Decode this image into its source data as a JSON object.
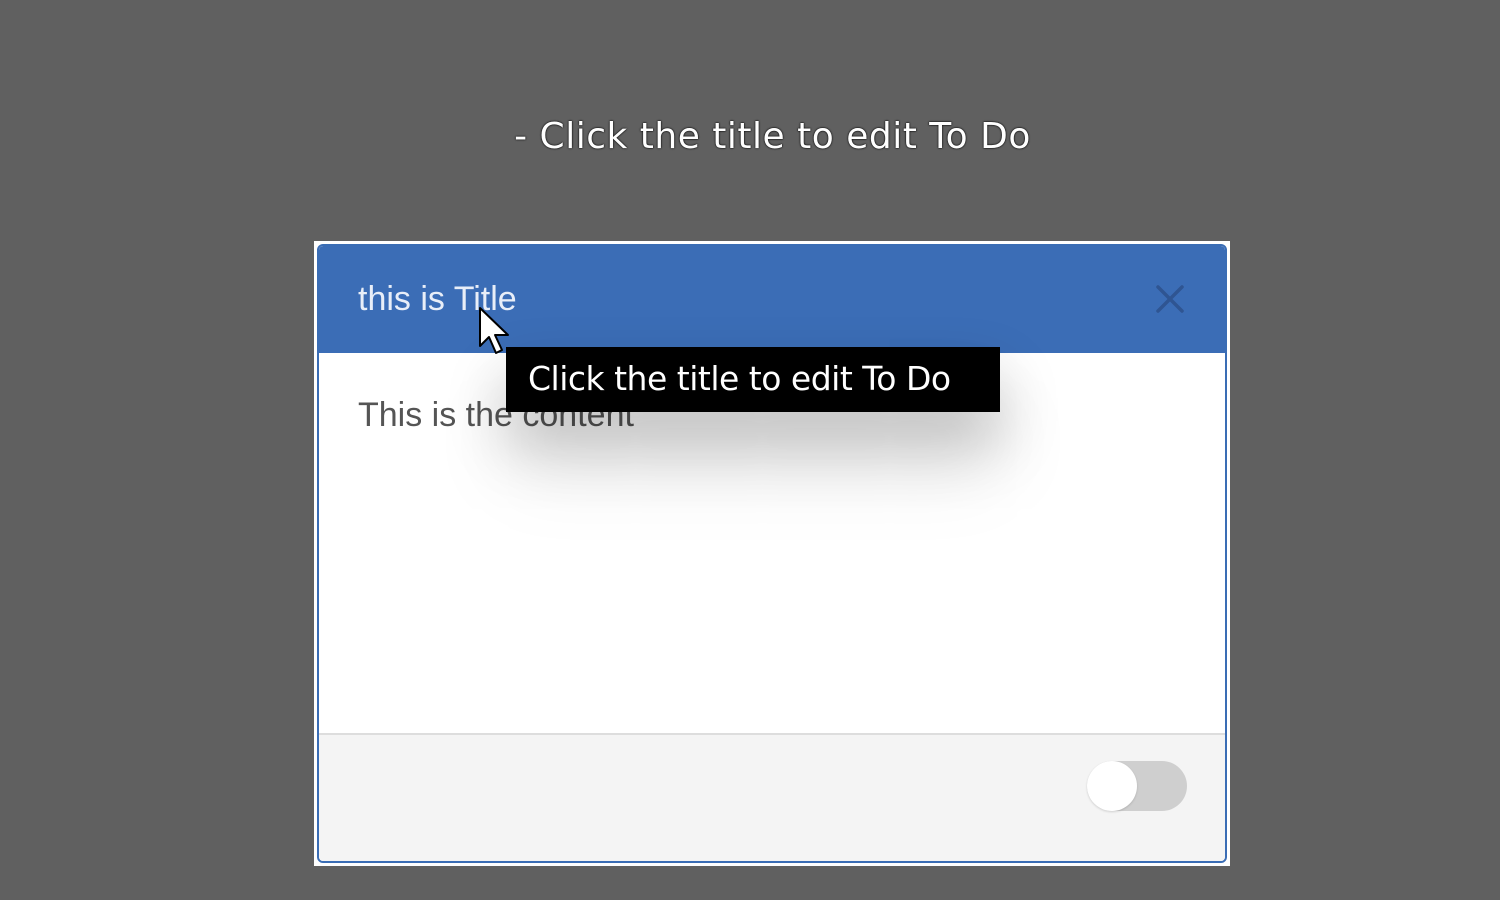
{
  "caption": "- Click the title to edit To Do",
  "card": {
    "title": "this is Title",
    "content": "This is the content",
    "close_icon": "close-icon",
    "toggle_state": "off"
  },
  "tooltip": {
    "text": "Click the title to edit To Do"
  },
  "colors": {
    "background": "#606060",
    "header": "#3b6db6",
    "tooltip_bg": "#000000",
    "footer": "#f4f4f4",
    "toggle_track": "#cfcfcf"
  }
}
